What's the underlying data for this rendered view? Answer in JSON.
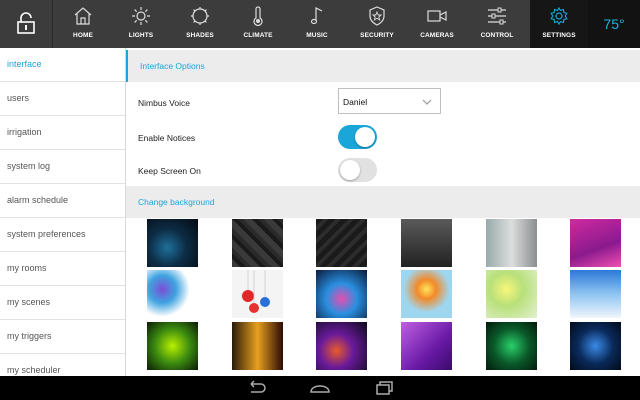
{
  "header": {
    "nav": [
      {
        "label": "HOME",
        "icon": "home-icon"
      },
      {
        "label": "LIGHTS",
        "icon": "sun-icon"
      },
      {
        "label": "SHADES",
        "icon": "shade-icon"
      },
      {
        "label": "CLIMATE",
        "icon": "thermometer-icon"
      },
      {
        "label": "MUSIC",
        "icon": "music-note-icon"
      },
      {
        "label": "SECURITY",
        "icon": "shield-icon"
      },
      {
        "label": "CAMERAS",
        "icon": "camera-icon"
      },
      {
        "label": "CONTROL",
        "icon": "sliders-icon"
      },
      {
        "label": "SETTINGS",
        "icon": "gear-icon",
        "active": true
      }
    ],
    "temperature": "75°",
    "accent": "#1aa6d8"
  },
  "sidebar": {
    "items": [
      {
        "label": "interface",
        "active": true
      },
      {
        "label": "users"
      },
      {
        "label": "irrigation"
      },
      {
        "label": "system log"
      },
      {
        "label": "alarm schedule"
      },
      {
        "label": "system preferences"
      },
      {
        "label": "my rooms"
      },
      {
        "label": "my scenes"
      },
      {
        "label": "my triggers"
      },
      {
        "label": "my scheduler"
      }
    ]
  },
  "main": {
    "interface_title": "Interface Options",
    "voice_label": "Nimbus Voice",
    "voice_value": "Daniel",
    "notices_label": "Enable Notices",
    "notices_on": true,
    "screen_label": "Keep Screen On",
    "screen_on": false,
    "background_title": "Change background"
  },
  "system_nav": [
    "back-icon",
    "home-icon",
    "recents-icon"
  ]
}
